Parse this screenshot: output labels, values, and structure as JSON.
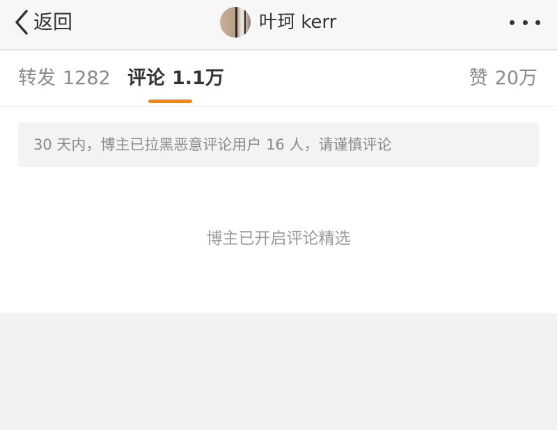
{
  "nav": {
    "back_label": "返回",
    "title": "叶珂 kerr",
    "icons": {
      "back": "chevron-left-icon",
      "more": "more-dots-icon"
    }
  },
  "tabs": [
    {
      "label": "转发",
      "count": "1282",
      "active": false
    },
    {
      "label": "评论",
      "count": "1.1万",
      "active": true
    },
    {
      "label": "赞",
      "count": "20万",
      "active": false
    }
  ],
  "notice": "30 天内，博主已拉黑恶意评论用户 16 人，请谨慎评论",
  "status_message": "博主已开启评论精选",
  "colors": {
    "accent": "#ff8200",
    "nav_bg": "#f7f7f7",
    "page_bg": "#f2f2f2",
    "notice_bg": "#f3f3f3"
  }
}
